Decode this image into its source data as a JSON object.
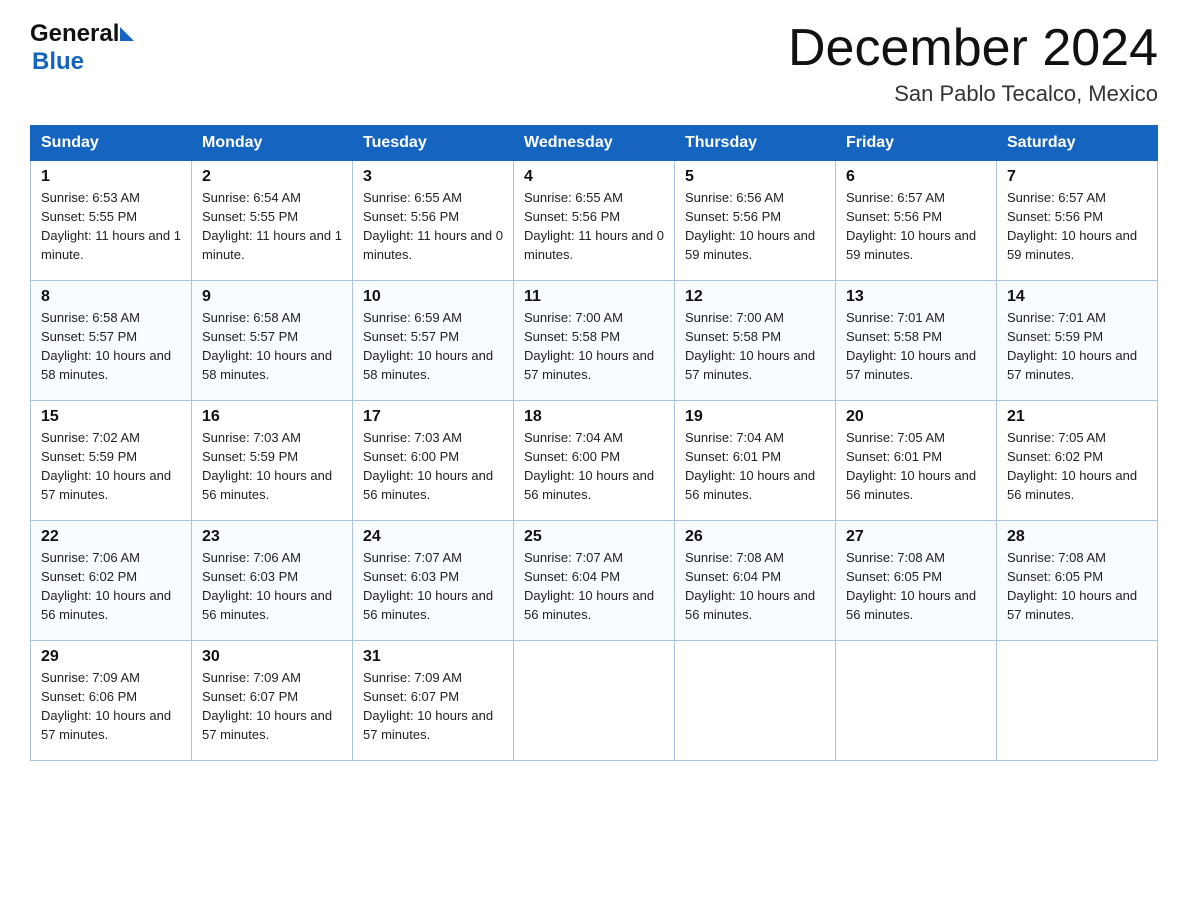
{
  "header": {
    "logo_general": "General",
    "logo_blue": "Blue",
    "month_title": "December 2024",
    "location": "San Pablo Tecalco, Mexico"
  },
  "days_of_week": [
    "Sunday",
    "Monday",
    "Tuesday",
    "Wednesday",
    "Thursday",
    "Friday",
    "Saturday"
  ],
  "weeks": [
    [
      {
        "day": "1",
        "sunrise": "6:53 AM",
        "sunset": "5:55 PM",
        "daylight": "11 hours and 1 minute."
      },
      {
        "day": "2",
        "sunrise": "6:54 AM",
        "sunset": "5:55 PM",
        "daylight": "11 hours and 1 minute."
      },
      {
        "day": "3",
        "sunrise": "6:55 AM",
        "sunset": "5:56 PM",
        "daylight": "11 hours and 0 minutes."
      },
      {
        "day": "4",
        "sunrise": "6:55 AM",
        "sunset": "5:56 PM",
        "daylight": "11 hours and 0 minutes."
      },
      {
        "day": "5",
        "sunrise": "6:56 AM",
        "sunset": "5:56 PM",
        "daylight": "10 hours and 59 minutes."
      },
      {
        "day": "6",
        "sunrise": "6:57 AM",
        "sunset": "5:56 PM",
        "daylight": "10 hours and 59 minutes."
      },
      {
        "day": "7",
        "sunrise": "6:57 AM",
        "sunset": "5:56 PM",
        "daylight": "10 hours and 59 minutes."
      }
    ],
    [
      {
        "day": "8",
        "sunrise": "6:58 AM",
        "sunset": "5:57 PM",
        "daylight": "10 hours and 58 minutes."
      },
      {
        "day": "9",
        "sunrise": "6:58 AM",
        "sunset": "5:57 PM",
        "daylight": "10 hours and 58 minutes."
      },
      {
        "day": "10",
        "sunrise": "6:59 AM",
        "sunset": "5:57 PM",
        "daylight": "10 hours and 58 minutes."
      },
      {
        "day": "11",
        "sunrise": "7:00 AM",
        "sunset": "5:58 PM",
        "daylight": "10 hours and 57 minutes."
      },
      {
        "day": "12",
        "sunrise": "7:00 AM",
        "sunset": "5:58 PM",
        "daylight": "10 hours and 57 minutes."
      },
      {
        "day": "13",
        "sunrise": "7:01 AM",
        "sunset": "5:58 PM",
        "daylight": "10 hours and 57 minutes."
      },
      {
        "day": "14",
        "sunrise": "7:01 AM",
        "sunset": "5:59 PM",
        "daylight": "10 hours and 57 minutes."
      }
    ],
    [
      {
        "day": "15",
        "sunrise": "7:02 AM",
        "sunset": "5:59 PM",
        "daylight": "10 hours and 57 minutes."
      },
      {
        "day": "16",
        "sunrise": "7:03 AM",
        "sunset": "5:59 PM",
        "daylight": "10 hours and 56 minutes."
      },
      {
        "day": "17",
        "sunrise": "7:03 AM",
        "sunset": "6:00 PM",
        "daylight": "10 hours and 56 minutes."
      },
      {
        "day": "18",
        "sunrise": "7:04 AM",
        "sunset": "6:00 PM",
        "daylight": "10 hours and 56 minutes."
      },
      {
        "day": "19",
        "sunrise": "7:04 AM",
        "sunset": "6:01 PM",
        "daylight": "10 hours and 56 minutes."
      },
      {
        "day": "20",
        "sunrise": "7:05 AM",
        "sunset": "6:01 PM",
        "daylight": "10 hours and 56 minutes."
      },
      {
        "day": "21",
        "sunrise": "7:05 AM",
        "sunset": "6:02 PM",
        "daylight": "10 hours and 56 minutes."
      }
    ],
    [
      {
        "day": "22",
        "sunrise": "7:06 AM",
        "sunset": "6:02 PM",
        "daylight": "10 hours and 56 minutes."
      },
      {
        "day": "23",
        "sunrise": "7:06 AM",
        "sunset": "6:03 PM",
        "daylight": "10 hours and 56 minutes."
      },
      {
        "day": "24",
        "sunrise": "7:07 AM",
        "sunset": "6:03 PM",
        "daylight": "10 hours and 56 minutes."
      },
      {
        "day": "25",
        "sunrise": "7:07 AM",
        "sunset": "6:04 PM",
        "daylight": "10 hours and 56 minutes."
      },
      {
        "day": "26",
        "sunrise": "7:08 AM",
        "sunset": "6:04 PM",
        "daylight": "10 hours and 56 minutes."
      },
      {
        "day": "27",
        "sunrise": "7:08 AM",
        "sunset": "6:05 PM",
        "daylight": "10 hours and 56 minutes."
      },
      {
        "day": "28",
        "sunrise": "7:08 AM",
        "sunset": "6:05 PM",
        "daylight": "10 hours and 57 minutes."
      }
    ],
    [
      {
        "day": "29",
        "sunrise": "7:09 AM",
        "sunset": "6:06 PM",
        "daylight": "10 hours and 57 minutes."
      },
      {
        "day": "30",
        "sunrise": "7:09 AM",
        "sunset": "6:07 PM",
        "daylight": "10 hours and 57 minutes."
      },
      {
        "day": "31",
        "sunrise": "7:09 AM",
        "sunset": "6:07 PM",
        "daylight": "10 hours and 57 minutes."
      },
      null,
      null,
      null,
      null
    ]
  ]
}
